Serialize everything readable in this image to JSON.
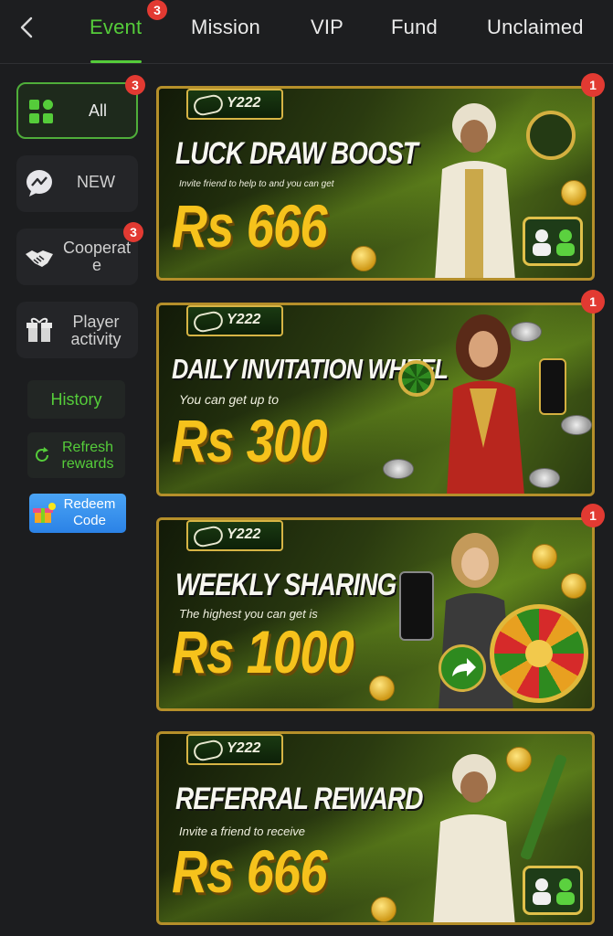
{
  "header": {
    "tabs": [
      {
        "label": "Event",
        "badge": "3"
      },
      {
        "label": "Mission"
      },
      {
        "label": "VIP"
      },
      {
        "label": "Fund"
      },
      {
        "label": "Unclaimed"
      }
    ]
  },
  "sidebar": {
    "items": [
      {
        "label": "All",
        "badge": "3"
      },
      {
        "label": "NEW"
      },
      {
        "label": "Cooperat\ne",
        "badge": "3"
      },
      {
        "label": "Player\nactivity"
      }
    ],
    "history_label": "History",
    "refresh_label": "Refresh\nrewards",
    "redeem_label": "Redeem\nCode"
  },
  "banners": [
    {
      "brand": "Y222",
      "title": "LUCK DRAW BOOST",
      "subtitle": "Invite friend to help to and you can get",
      "amount": "Rs 666",
      "badge": "1"
    },
    {
      "brand": "Y222",
      "title": "DAILY INVITATION WHEEL",
      "subtitle": "You can get up to",
      "amount": "Rs 300",
      "badge": "1"
    },
    {
      "brand": "Y222",
      "title": "WEEKLY SHARING",
      "subtitle": "The highest you can get is",
      "amount": "Rs 1000",
      "badge": "1"
    },
    {
      "brand": "Y222",
      "title": "REFERRAL REWARD",
      "subtitle": "Invite a friend to receive",
      "amount": "Rs 666"
    }
  ],
  "colors": {
    "accent": "#55cc3a",
    "badge": "#e23a32",
    "amount": "#f6c21c",
    "banner_border": "#b58f2a"
  },
  "icons": [
    "back-chevron-icon",
    "grid-icon",
    "messenger-icon",
    "handshake-icon",
    "gift-icon",
    "refresh-icon",
    "gift-box-icon",
    "invite-friend-icon"
  ]
}
